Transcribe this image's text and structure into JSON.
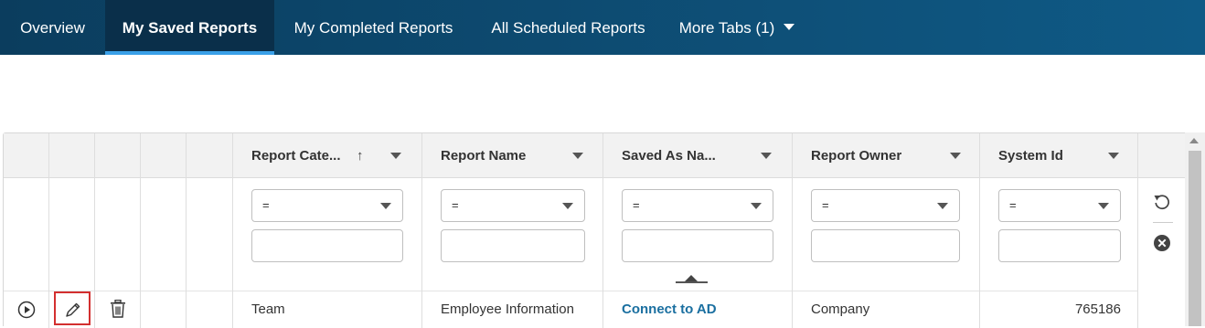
{
  "tabs": [
    {
      "label": "Overview",
      "active": false
    },
    {
      "label": "My Saved Reports",
      "active": true
    },
    {
      "label": "My Completed Reports",
      "active": false
    },
    {
      "label": "All Scheduled Reports",
      "active": false
    },
    {
      "label": "More Tabs (1)",
      "active": false
    }
  ],
  "grid": {
    "columns": [
      {
        "label": "Report Cate...",
        "sort": "ascending"
      },
      {
        "label": "Report Name"
      },
      {
        "label": "Saved As Na..."
      },
      {
        "label": "Report Owner"
      },
      {
        "label": "System Id"
      }
    ],
    "filters": [
      {
        "operator": "=",
        "value": ""
      },
      {
        "operator": "=",
        "value": ""
      },
      {
        "operator": "=",
        "value": ""
      },
      {
        "operator": "=",
        "value": ""
      },
      {
        "operator": "=",
        "value": ""
      }
    ],
    "sort_arrow": "↑",
    "rows": [
      {
        "report_category": "Team",
        "report_name": "Employee Information",
        "saved_as_name": "Connect to AD",
        "report_owner": "Company",
        "system_id": "765186"
      }
    ]
  },
  "icons": {
    "run": "play-icon",
    "edit": "pencil-icon",
    "delete": "trash-icon",
    "reset": "reset-icon",
    "clear": "clear-icon"
  },
  "colors": {
    "tabbar": "#0d4a70",
    "active_tab": "#0a2f4a",
    "active_indicator": "#3aa0e8",
    "link": "#1a6fa0",
    "edit_highlight": "#d32f2f"
  }
}
